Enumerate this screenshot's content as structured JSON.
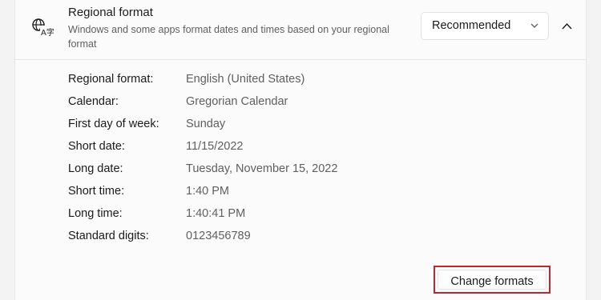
{
  "section": {
    "title": "Regional format",
    "description": "Windows and some apps format dates and times based on your regional format",
    "icon": "language-globe-icon"
  },
  "dropdown": {
    "selected": "Recommended"
  },
  "details": [
    {
      "label": "Regional format:",
      "value": "English (United States)"
    },
    {
      "label": "Calendar:",
      "value": "Gregorian Calendar"
    },
    {
      "label": "First day of week:",
      "value": "Sunday"
    },
    {
      "label": "Short date:",
      "value": "11/15/2022"
    },
    {
      "label": "Long date:",
      "value": "Tuesday, November 15, 2022"
    },
    {
      "label": "Short time:",
      "value": "1:40 PM"
    },
    {
      "label": "Long time:",
      "value": "1:40:41 PM"
    },
    {
      "label": "Standard digits:",
      "value": "0123456789"
    }
  ],
  "actions": {
    "change_formats": "Change formats"
  },
  "colors": {
    "highlight": "#c1272d",
    "secondary_text": "#5f5f5f"
  }
}
